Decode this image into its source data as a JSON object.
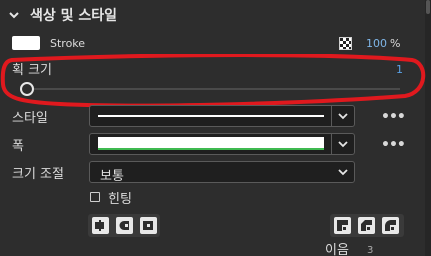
{
  "section": {
    "title": "색상 및 스타일",
    "icon": "chevron-down-icon"
  },
  "stroke": {
    "label": "Stroke",
    "swatch_color": "#ffffff",
    "opacity_value": "100",
    "opacity_unit": "%"
  },
  "stroke_size": {
    "label": "획 크기",
    "value": "1",
    "slider_fraction": 0.0
  },
  "style": {
    "label": "스타일",
    "more": "•••"
  },
  "width": {
    "label": "폭",
    "more": "•••"
  },
  "scale": {
    "label": "크기 조절",
    "selected": "보통"
  },
  "hinting": {
    "label": "힌팅",
    "checked": false
  },
  "join": {
    "label": "이음",
    "value": "3"
  },
  "colors": {
    "annotation": "#e0191e",
    "width_line": "#3fb950",
    "accent": "#5aa2e6"
  }
}
